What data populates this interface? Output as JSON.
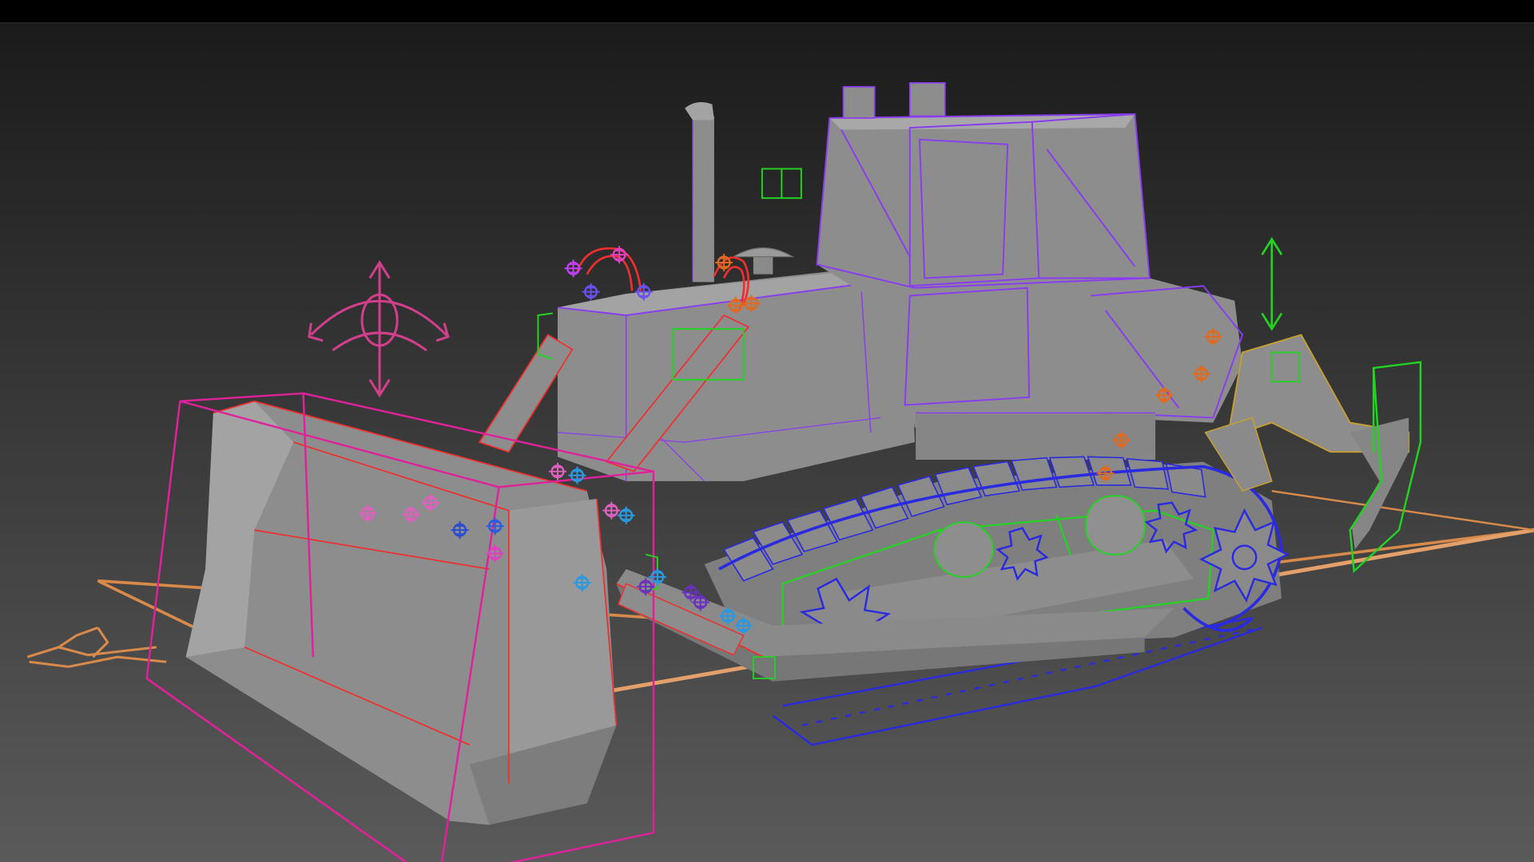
{
  "viewport": {
    "colors": {
      "bg_top": "#1b1b1b",
      "bg_bottom": "#5a5a5a",
      "body": "#8d8d8d",
      "body_dark": "#6e6e6e",
      "body_light": "#a3a3a3",
      "wire_purple": "#8a3cf0",
      "wire_magenta": "#e0229a",
      "wire_red": "#f02e2e",
      "wire_blue": "#2a2ae0",
      "wire_green": "#22d422",
      "wire_orange": "#d88a4a",
      "wire_gold": "#c8a030"
    },
    "helpers": {
      "blade_rotate_gizmo": "rotate-arrows-icon",
      "ripper_lift_gizmo": "vertical-arrows-icon",
      "point_helper": "crosshair-point-icon",
      "sprocket_helper": "star-gear-icon"
    }
  }
}
